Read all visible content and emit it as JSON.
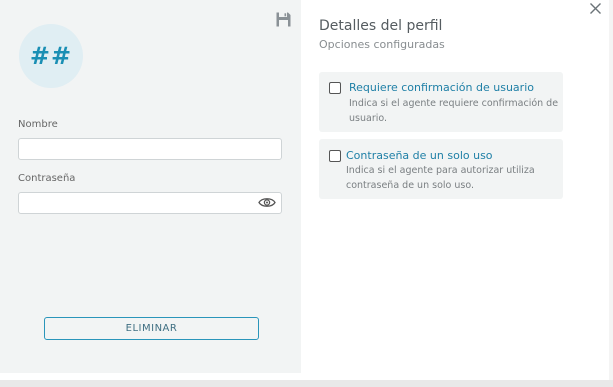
{
  "profile": {
    "avatar_text": "##",
    "name_label": "Nombre",
    "name_value": "",
    "password_label": "Contraseña",
    "password_value": "",
    "delete_label": "ELIMINAR"
  },
  "details": {
    "title": "Detalles del perfil",
    "subtitle": "Opciones configuradas",
    "options": [
      {
        "title": "Requiere confirmación de usuario",
        "description": "Indica si el agente requiere confirmación de usuario.",
        "checked": false
      },
      {
        "title": "Contraseña de un solo uso",
        "description": "Indica si el agente para autorizar utiliza contraseña de un solo uso.",
        "checked": false
      }
    ]
  },
  "icons": {
    "save": "save-icon",
    "show_password": "eye-icon",
    "close": "close-icon"
  },
  "colors": {
    "accent": "#1e7fa6",
    "panel_bg": "#f2f4f4",
    "avatar_bg": "#e0eef3"
  }
}
